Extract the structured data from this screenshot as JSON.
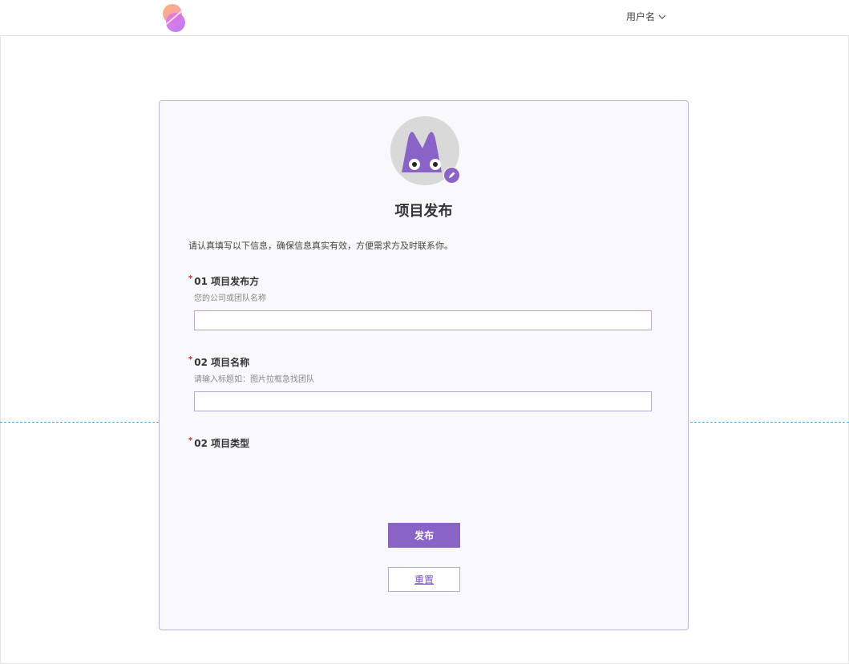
{
  "header": {
    "logo_icon": "brand-logo",
    "user_menu_label": "用户名",
    "user_menu_icon": "chevron-down-icon"
  },
  "form": {
    "avatar_icon": "avatar-mascot",
    "edit_icon": "pencil-icon",
    "title": "项目发布",
    "intro": "请认真填写以下信息，确保信息真实有效，方便需求方及时联系你。",
    "required_mark": "*",
    "fields": [
      {
        "label": "01 项目发布方",
        "hint": "您的公司或团队名称",
        "value": ""
      },
      {
        "label": "02 项目名称",
        "hint": "请输入标题如：图片拉框急找团队",
        "value": ""
      },
      {
        "label": "02 项目类型"
      }
    ],
    "submit_label": "发布",
    "reset_label": "重置"
  },
  "colors": {
    "accent": "#8a63c6",
    "card_background": "#f9f8fd",
    "card_border": "#bfb2d9",
    "required": "#e02020"
  }
}
